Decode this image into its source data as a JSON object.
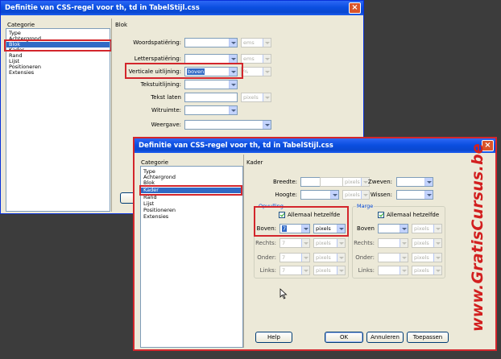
{
  "back_dialog": {
    "title": "Definitie van CSS-regel voor th, td in TabelStijl.css",
    "category_header": "Categorie",
    "section_title": "Blok",
    "categories": [
      "Type",
      "Achtergrond",
      "Blok",
      "Kader",
      "Rand",
      "Lijst",
      "Positioneren",
      "Extensies"
    ],
    "selected_category": "Blok",
    "fields": {
      "woordspatiering_label": "Woordspatiëring:",
      "letterspatiering_label": "Letterspatiëring:",
      "verticale_uitlijning_label": "Verticale uitlijning:",
      "verticale_uitlijning_value": "boven",
      "tekstuitlijning_label": "Tekstuitlijning:",
      "tekst_laten_label": "Tekst laten",
      "witruimte_label": "Witruimte:",
      "weergave_label": "Weergave:",
      "unit_ems": "ems",
      "unit_pixels": "pixels",
      "unit_percent": "%"
    }
  },
  "front_dialog": {
    "title": "Definitie van CSS-regel voor th, td in TabelStijl.css",
    "category_header": "Categorie",
    "section_title": "Kader",
    "categories": [
      "Type",
      "Achtergrond",
      "Blok",
      "Kader",
      "Rand",
      "Lijst",
      "Positioneren",
      "Extensies"
    ],
    "selected_category": "Kader",
    "breedte_label": "Breedte:",
    "hoogte_label": "Hoogte:",
    "zweven_label": "Zweven:",
    "wissen_label": "Wissen:",
    "unit_pixels": "pixels",
    "opvulling": {
      "title": "Opvulling",
      "same_label": "Allemaal hetzelfde",
      "boven_label": "Boven:",
      "boven_value": "7",
      "boven_unit": "pixels",
      "rechts_label": "Rechts:",
      "onder_label": "Onder:",
      "links_label": "Links:",
      "value": "7",
      "unit": "pixels"
    },
    "marge": {
      "title": "Marge",
      "same_label": "Allemaal hetzelfde",
      "boven_label": "Boven",
      "rechts_label": "Rechts:",
      "onder_label": "Onder:",
      "links_label": "Links:",
      "unit": "pixels"
    },
    "buttons": {
      "help": "Help",
      "ok": "OK",
      "annuleren": "Annuleren",
      "toepassen": "Toepassen"
    }
  },
  "watermark": "www.GratisCursus.be",
  "colors": {
    "highlight_red": "#d3262c",
    "title_blue": "#0b4fe0",
    "selection_blue": "#316ac5",
    "watermark_red": "#d21f1f"
  }
}
